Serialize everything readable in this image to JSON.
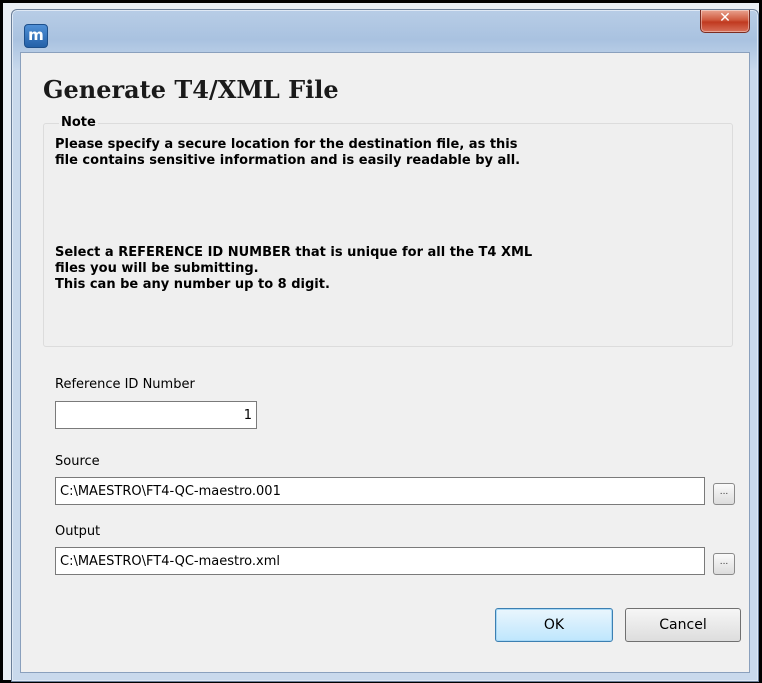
{
  "window": {
    "app_icon_glyph": "m",
    "close_glyph": "✕"
  },
  "dialog": {
    "title": "Generate T4/XML File",
    "note_label": "Note",
    "note_line1": "Please specify a secure location for the destination file, as this",
    "note_line2": "file contains sensitive information and is easily readable by all.",
    "note_line3": "Select a REFERENCE ID NUMBER that is unique for all the T4 XML",
    "note_line4": "files you will be submitting.",
    "note_line5": "This can be any number up to 8 digit."
  },
  "reference": {
    "label": "Reference ID Number",
    "value": "1"
  },
  "source": {
    "label": "Source",
    "value": "C:\\MAESTRO\\FT4-QC-maestro.001",
    "browse_label": "..."
  },
  "output": {
    "label": "Output",
    "value": "C:\\MAESTRO\\FT4-QC-maestro.xml",
    "browse_label": "..."
  },
  "buttons": {
    "ok": "OK",
    "cancel": "Cancel"
  }
}
